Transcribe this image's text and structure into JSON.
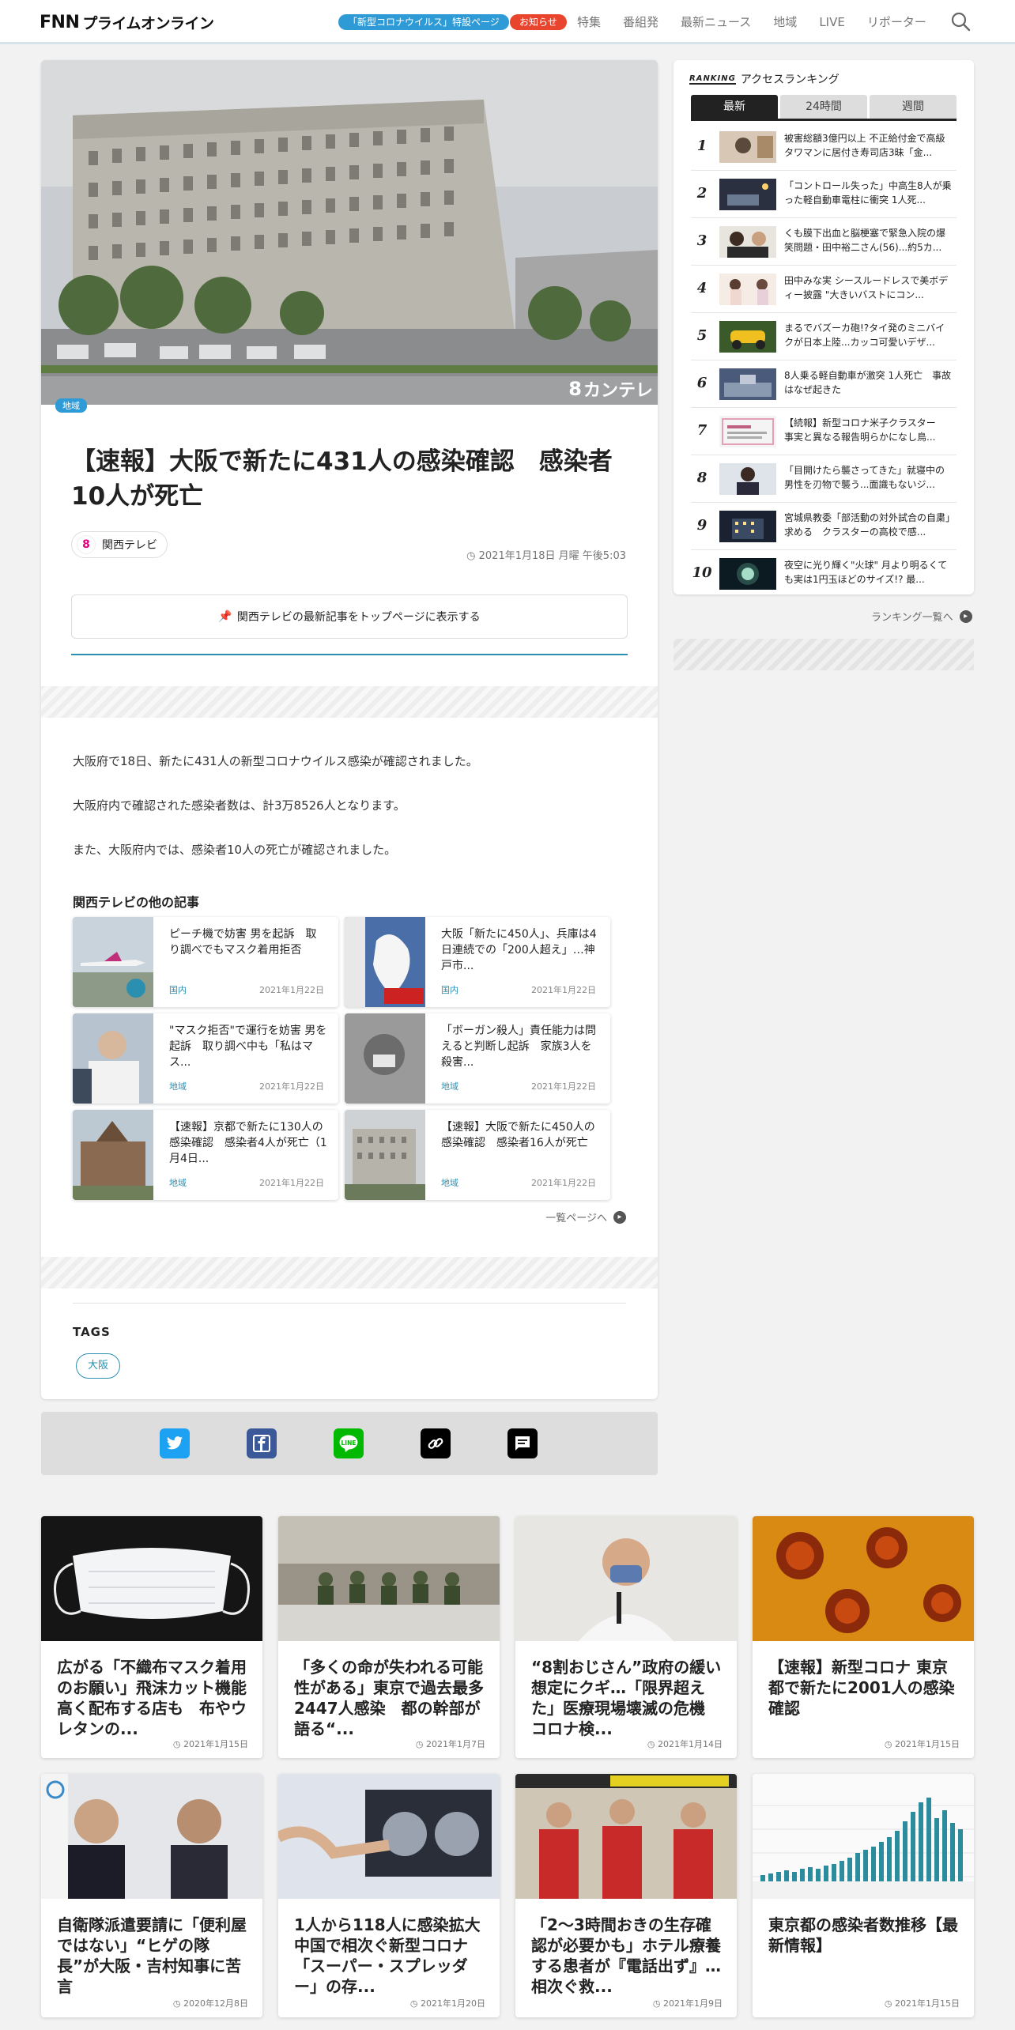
{
  "header": {
    "logo": "プライムオンライン",
    "logo_mark": "FNN",
    "covid_pill": "「新型コロナウイルス」特設ページ",
    "notice_pill": "お知らせ",
    "nav": [
      "特集",
      "番組発",
      "最新ニュース",
      "地域",
      "LIVE",
      "リポーター"
    ]
  },
  "article": {
    "tag": "地域",
    "image_watermark": "カンテレ",
    "title": "【速報】大阪で新たに431人の感染確認　感染者10人が死亡",
    "source": "関西テレビ",
    "source_mark": "8",
    "date": "2021年1月18日 月曜 午後5:03",
    "pin_button": "関西テレビの最新記事をトップページに表示する",
    "paragraphs": [
      "大阪府で18日、新たに431人の新型コロナウイルス感染が確認されました。",
      "大阪府内で確認された感染者数は、計3万8526人となります。",
      "また、大阪府内では、感染者10人の死亡が確認されました。"
    ]
  },
  "related": {
    "title": "関西テレビの他の記事",
    "items": [
      {
        "title": "ピーチ機で妨害 男を起訴　取り調べでもマスク着用拒否",
        "category": "国内",
        "date": "2021年1月22日"
      },
      {
        "title": "大阪「新たに450人」、兵庫は4日連続での「200人超え」…神戸市...",
        "category": "国内",
        "date": "2021年1月22日"
      },
      {
        "title": "\"マスク拒否\"で運行を妨害 男を起訴　取り調べ中も「私はマス...",
        "category": "地域",
        "date": "2021年1月22日"
      },
      {
        "title": "「ボーガン殺人」責任能力は問えると判断し起訴　家族3人を殺害...",
        "category": "地域",
        "date": "2021年1月22日"
      },
      {
        "title": "【速報】京都で新たに130人の感染確認　感染者4人が死亡（1月4日...",
        "category": "地域",
        "date": "2021年1月22日"
      },
      {
        "title": "【速報】大阪で新たに450人の感染確認　感染者16人が死亡",
        "category": "地域",
        "date": "2021年1月22日"
      }
    ],
    "more": "一覧ページへ"
  },
  "tags": {
    "title": "TAGS",
    "items": [
      "大阪"
    ]
  },
  "ranking": {
    "label": "RANKING",
    "title": "アクセスランキング",
    "tabs": [
      "最新",
      "24時間",
      "週間"
    ],
    "items": [
      {
        "no": "1",
        "title": "被害総額3億円以上 不正給付金で高級タワマンに居付き寿司店3昧「金..."
      },
      {
        "no": "2",
        "title": "「コントロール失った」中高生8人が乗った軽自動車電柱に衝突 1人死..."
      },
      {
        "no": "3",
        "title": "くも膜下出血と脳梗塞で緊急入院の爆笑問題・田中裕二さん(56)...約5カ..."
      },
      {
        "no": "4",
        "title": "田中みな実 シースルードレスで美ボディー披露 \"大きいバストにコン..."
      },
      {
        "no": "5",
        "title": "まるでバズーカ砲!?タイ発のミニバイクが日本上陸...カッコ可愛いデザ..."
      },
      {
        "no": "6",
        "title": "8人乗る軽自動車が激突 1人死亡　事故はなぜ起きた"
      },
      {
        "no": "7",
        "title": "【続報】新型コロナ米子クラスター　事実と異なる報告明らかになし鳥..."
      },
      {
        "no": "8",
        "title": "「目開けたら襲さってきた」就寝中の男性を刃物で襲う...面識もないジ..."
      },
      {
        "no": "9",
        "title": "宮城県教委「部活動の対外試合の自粛」求める　クラスターの高校で感..."
      },
      {
        "no": "10",
        "title": "夜空に光り輝く\"火球\" 月より明るくても実は1円玉ほどのサイズ!? 最..."
      }
    ],
    "more": "ランキング一覧へ"
  },
  "grid": [
    {
      "title": "広がる「不織布マスク着用のお願い」飛沫カット機能高く配布する店も　布やウレタンの...",
      "date": "2021年1月15日"
    },
    {
      "title": "「多くの命が失われる可能性がある」東京で過去最多2447人感染　都の幹部が語る“...",
      "date": "2021年1月7日"
    },
    {
      "title": "“8割おじさん”政府の緩い想定にクギ…「限界超えた」医療現場壊滅の危機 コロナ検...",
      "date": "2021年1月14日"
    },
    {
      "title": "【速報】新型コロナ 東京都で新たに2001人の感染確認",
      "date": "2021年1月15日"
    },
    {
      "title": "自衛隊派遣要請に「便利屋ではない」“ヒゲの隊長”が大阪・吉村知事に苦言",
      "date": "2020年12月8日"
    },
    {
      "title": "1人から118人に感染拡大　中国で相次ぐ新型コロナ「スーパー・スプレッダー」の存...",
      "date": "2021年1月20日"
    },
    {
      "title": "「2～3時間おきの生存確認が必要かも」ホテル療養する患者が『電話出ず』…相次ぐ救...",
      "date": "2021年1月9日"
    },
    {
      "title": "東京都の感染者数推移【最新情報】",
      "date": "2021年1月15日"
    }
  ],
  "colors": {
    "accent": "#2b8fb0",
    "covid": "#2e9bd6",
    "notice": "#e9442e"
  }
}
